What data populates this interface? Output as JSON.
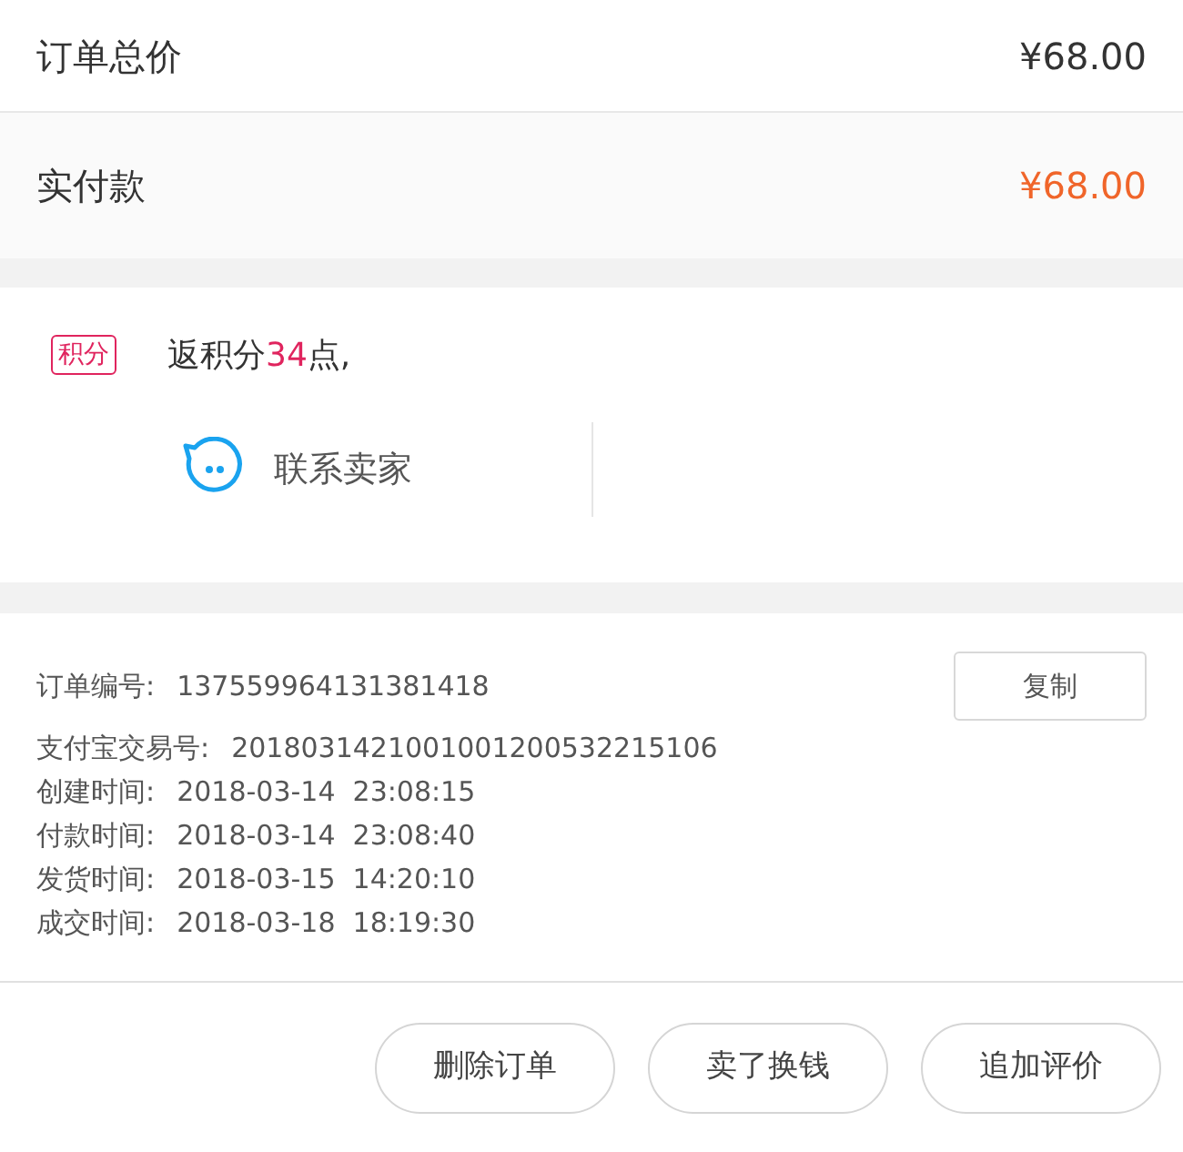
{
  "total": {
    "label": "订单总价",
    "value": "¥68.00"
  },
  "paid": {
    "label": "实付款",
    "value": "¥68.00"
  },
  "points": {
    "badge": "积分",
    "prefix": "返积分",
    "amount": "34",
    "suffix": "点,"
  },
  "contact": {
    "label": "联系卖家"
  },
  "info": {
    "rows": [
      {
        "label": "订单编号:",
        "value": "137559964131381418",
        "copy": "复制"
      },
      {
        "label": "支付宝交易号:",
        "value": "2018031421001001200532215106"
      },
      {
        "label": "创建时间:",
        "value": "2018-03-14  23:08:15"
      },
      {
        "label": "付款时间:",
        "value": "2018-03-14  23:08:40"
      },
      {
        "label": "发货时间:",
        "value": "2018-03-15  14:20:10"
      },
      {
        "label": "成交时间:",
        "value": "2018-03-18  18:19:30"
      }
    ]
  },
  "buttons": [
    "删除订单",
    "卖了换钱",
    "追加评价"
  ]
}
